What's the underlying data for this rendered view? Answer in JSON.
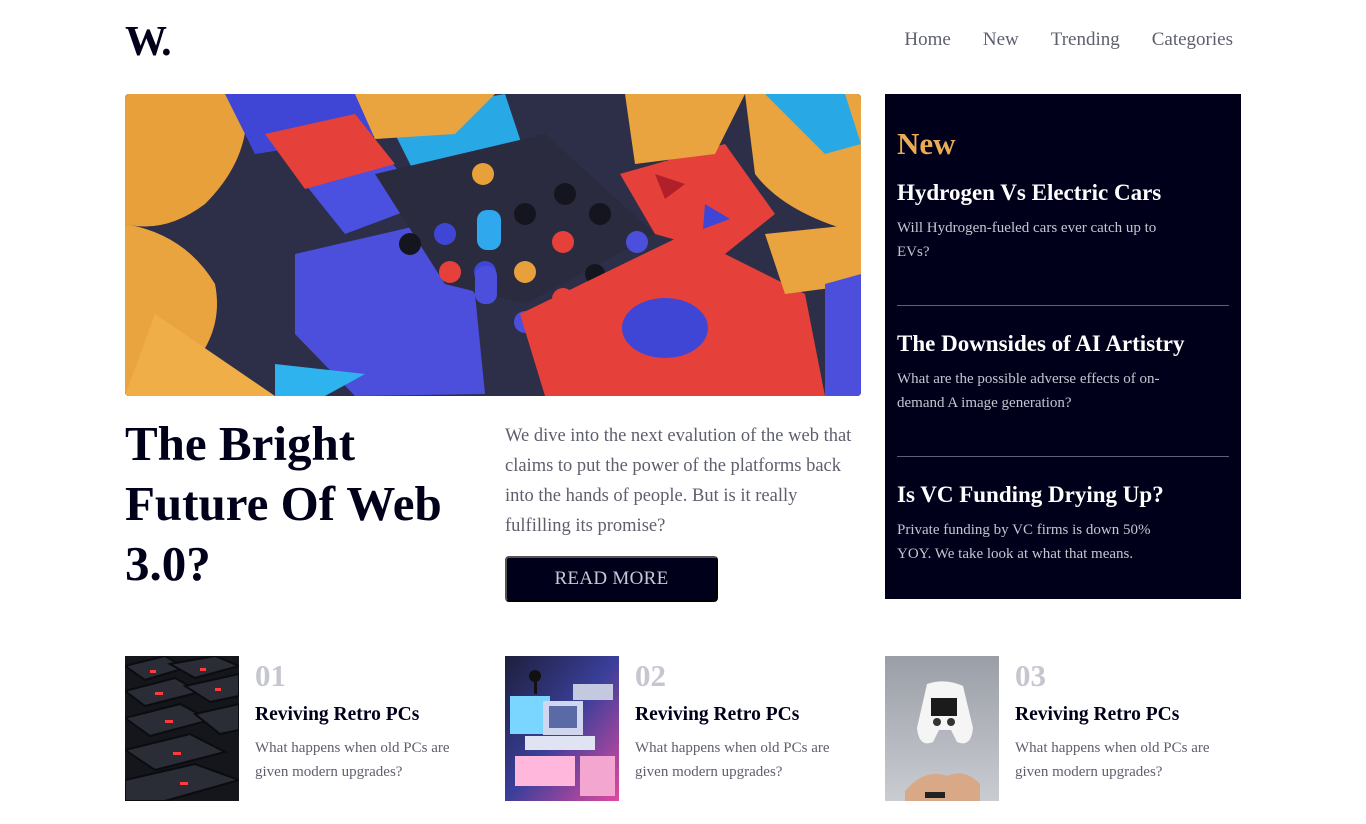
{
  "header": {
    "logo": "W.",
    "nav": [
      "Home",
      "New",
      "Trending",
      "Categories"
    ]
  },
  "hero": {
    "title": "The Bright Future Of Web 3.0?",
    "description": "We dive into the next evalution of the web that claims to put the power of the platforms back into the hands of people. But is it really fulfilling its promise?",
    "button_label": "READ MORE"
  },
  "sidebar": {
    "heading": "New",
    "items": [
      {
        "title": "Hydrogen Vs Electric Cars",
        "description": "Will Hydrogen-fueled cars ever catch up to EVs?"
      },
      {
        "title": "The Downsides of AI Artistry",
        "description": "What are the possible adverse effects of on-demand A image generation?"
      },
      {
        "title": "Is VC Funding Drying Up?",
        "description": "Private funding by VC firms is down 50% YOY. We take look at what that means."
      }
    ]
  },
  "cards": [
    {
      "number": "01",
      "title": "Reviving Retro PCs",
      "description": "What happens when old PCs are given modern upgrades?"
    },
    {
      "number": "02",
      "title": "Reviving Retro PCs",
      "description": "What happens when old PCs are given modern upgrades?"
    },
    {
      "number": "03",
      "title": "Reviving Retro PCs",
      "description": "What happens when old PCs are given modern upgrades?"
    }
  ],
  "colors": {
    "dark": "#00001a",
    "accent": "#e9ab53",
    "muted_text": "#5d5f6d",
    "number_grey": "#c5c6d0"
  }
}
